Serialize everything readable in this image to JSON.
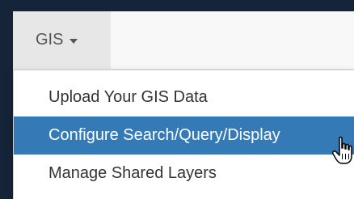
{
  "nav": {
    "tab_label": "GIS",
    "caret_icon": "caret-down-icon"
  },
  "menu": {
    "items": [
      {
        "label": "Upload Your GIS Data"
      },
      {
        "label": "Configure Search/Query/Display",
        "state": "hovered"
      },
      {
        "label": "Manage Shared Layers"
      }
    ]
  },
  "cursor_icon": "hand-pointer-icon",
  "colors": {
    "background": "#16243a",
    "navbar": "#f8f8f8",
    "active_tab": "#e7e7e7",
    "highlight": "#337ab7"
  }
}
